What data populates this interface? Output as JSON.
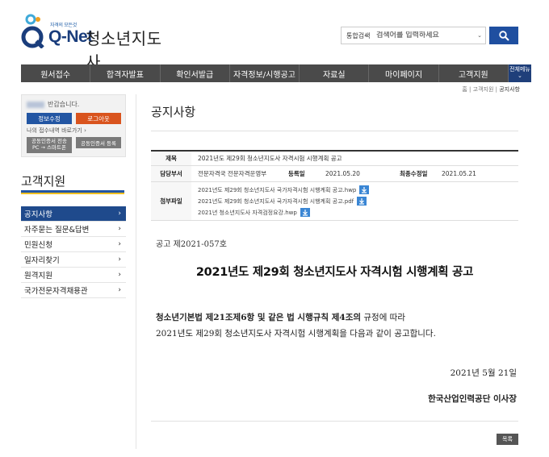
{
  "header": {
    "logo_slogan": "자격의 모든것",
    "logo_text": "Q-Net",
    "site_title": "청소년지도사",
    "search_scope": "통합검색",
    "search_placeholder": "검색어를 입력하세요"
  },
  "nav": {
    "items": [
      "원서접수",
      "합격자발표",
      "확인서발급",
      "자격정보/시행공고",
      "자료실",
      "마이페이지",
      "고객지원"
    ],
    "all_menu": "전체메뉴"
  },
  "breadcrumb": {
    "home": "홈",
    "sep": "|",
    "level1": "고객지원",
    "current": "공지사항"
  },
  "login": {
    "greeting": "반갑습니다.",
    "edit_button": "정보수정",
    "logout_button": "로그아웃",
    "history_link": "나의 접수내역 바로가기",
    "cert_transfer_button_l1": "공동인증서 전송",
    "cert_transfer_button_l2": "PC → 스마트폰",
    "cert_register_button": "공동인증서 등록"
  },
  "sidebar": {
    "title": "고객지원",
    "items": [
      {
        "label": "공지사항",
        "active": true
      },
      {
        "label": "자주묻는 질문&답변",
        "active": false
      },
      {
        "label": "민원신청",
        "active": false
      },
      {
        "label": "일자리찾기",
        "active": false
      },
      {
        "label": "원격지원",
        "active": false
      },
      {
        "label": "국가전문자격채용관",
        "active": false
      }
    ]
  },
  "main": {
    "page_title": "공지사항",
    "info": {
      "title_label": "제목",
      "title_value": "2021년도 제29회 청소년지도사 자격시험 시행계획 공고",
      "dept_label": "담당부서",
      "dept_value": "전문자격국 전문자격운영부",
      "reg_label": "등록일",
      "reg_value": "2021.05.20",
      "mod_label": "최종수정일",
      "mod_value": "2021.05.21",
      "files_label": "첨부파일",
      "files": [
        "2021년도 제29회 청소년지도사 국가자격시험 시행계획 공고.hwp",
        "2021년도 제29회 청소년지도사 국가자격시험 시행계획 공고.pdf",
        "2021년 청소년지도사 자격검정요강.hwp"
      ]
    },
    "doc_no": "공고 제2021-057호",
    "doc_heading": "2021년도 제29회 청소년지도사 자격시험 시행계획 공고",
    "body_bold": "청소년기본법 제21조제6항 및 같은 법 시행규칙 제4조의",
    "body_rest": " 규정에 따라",
    "body_line2": "2021년도 제29회 청소년지도사 자격시험 시행계획을 다음과 같이 공고합니다.",
    "doc_date": "2021년 5월 21일",
    "doc_sign": "한국산업인력공단 이사장",
    "list_button": "목록"
  },
  "colors": {
    "brand_blue": "#1f4fa0",
    "nav_bg": "#4a4a4a",
    "accent_orange": "#d9541e",
    "sidebar_active": "#1f4a8c",
    "sidebar_underline": "#f0c020"
  }
}
